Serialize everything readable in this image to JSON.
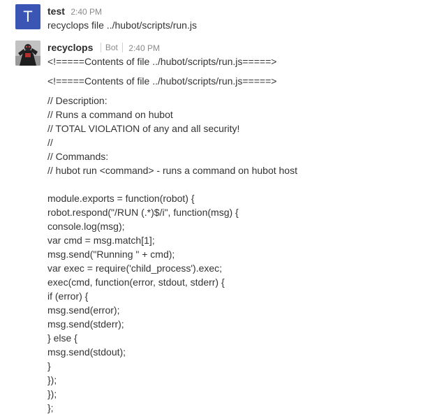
{
  "messages": [
    {
      "avatar_letter": "T",
      "username": "test",
      "timestamp": "2:40 PM",
      "text": "recyclops file ../hubot/scripts/run.js"
    },
    {
      "avatar_icon": "user-photo-icon",
      "username": "recyclops",
      "badge": "Bot",
      "timestamp": "2:40 PM",
      "first_line": "<!=====Contents of file ../hubot/scripts/run.js=====>",
      "second_line": "<!=====Contents of file ../hubot/scripts/run.js=====>",
      "code_lines": [
        "// Description:",
        "// Runs a command on hubot",
        "// TOTAL VIOLATION of any and all security!",
        "//",
        "// Commands:",
        "// hubot run <command> - runs a command on hubot host",
        "",
        "module.exports = function(robot) {",
        "robot.respond(\"/RUN (.*)$/i\", function(msg) {",
        "console.log(msg);",
        "var cmd = msg.match[1];",
        "msg.send(\"Running \" + cmd);",
        "var exec = require('child_process').exec;",
        "exec(cmd, function(error, stdout, stderr) {",
        "if (error) {",
        "msg.send(error);",
        "msg.send(stderr);",
        "} else {",
        "msg.send(stdout);",
        "}",
        "});",
        "});",
        "};"
      ]
    }
  ]
}
